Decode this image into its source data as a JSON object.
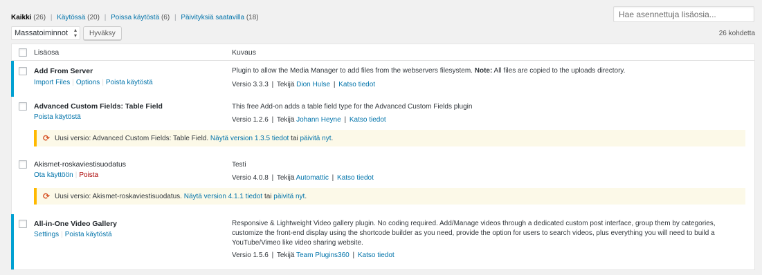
{
  "filters": [
    {
      "label": "Kaikki",
      "count": "(26)"
    },
    {
      "label": "Käytössä",
      "count": "(20)"
    },
    {
      "label": "Poissa käytöstä",
      "count": "(6)"
    },
    {
      "label": "Päivityksiä saatavilla",
      "count": "(18)"
    }
  ],
  "filter_separator": "|",
  "search": {
    "placeholder": "Hae asennettuja lisäosia..."
  },
  "bulk": {
    "label": "Massatoiminnot",
    "apply_label": "Hyväksy"
  },
  "items_count": "26 kohdetta",
  "columns": {
    "plugin": "Lisäosa",
    "description": "Kuvaus"
  },
  "meta_labels": {
    "by": "Tekijä",
    "details": "Katso tiedot",
    "pipe": "|"
  },
  "plugins": [
    {
      "name": "Add From Server",
      "actions": [
        "Import Files",
        "Options",
        "Poista käytöstä"
      ],
      "desc_pre": "Plugin to allow the Media Manager to add files from the webservers filesystem.",
      "desc_bold": "Note:",
      "desc_post": "All files are copied to the uploads directory.",
      "version": "Versio 3.3.3",
      "author": "Dion Hulse"
    },
    {
      "name": "Advanced Custom Fields: Table Field",
      "actions": [
        "Poista käytöstä"
      ],
      "desc": "This free Add-on adds a table field type for the Advanced Custom Fields plugin",
      "version": "Versio 1.2.6",
      "author": "Johann Heyne"
    },
    {
      "name": "Akismet-roskaviestisuodatus",
      "actions": [
        "Ota käyttöön",
        "Poista"
      ],
      "desc": "Testi",
      "version": "Versio 4.0.8",
      "author": "Automattic"
    },
    {
      "name": "All-in-One Video Gallery",
      "actions": [
        "Settings",
        "Poista käytöstä"
      ],
      "desc": "Responsive & Lightweight Video gallery plugin. No coding required. Add/Manage videos through a dedicated custom post interface, group them by categories, customize the front-end display using the shortcode builder as you need, provide the option for users to search videos, plus everything you will need to build a YouTube/Vimeo like video sharing website.",
      "version": "Versio 1.5.6",
      "author": "Team Plugins360"
    }
  ],
  "notices": [
    {
      "pre": "Uusi versio: Advanced Custom Fields: Table Field.",
      "link1": "Näytä version 1.3.5 tiedot",
      "mid": "tai",
      "link2": "päivitä nyt",
      "end": "."
    },
    {
      "pre": "Uusi versio: Akismet-roskaviestisuodatus.",
      "link1": "Näytä version 4.1.1 tiedot",
      "mid": "tai",
      "link2": "päivitä nyt",
      "end": "."
    }
  ],
  "colors": {
    "accent": "#0073aa",
    "active_border": "#00a0d2",
    "notice_border": "#ffb900",
    "delete": "#a00000"
  }
}
